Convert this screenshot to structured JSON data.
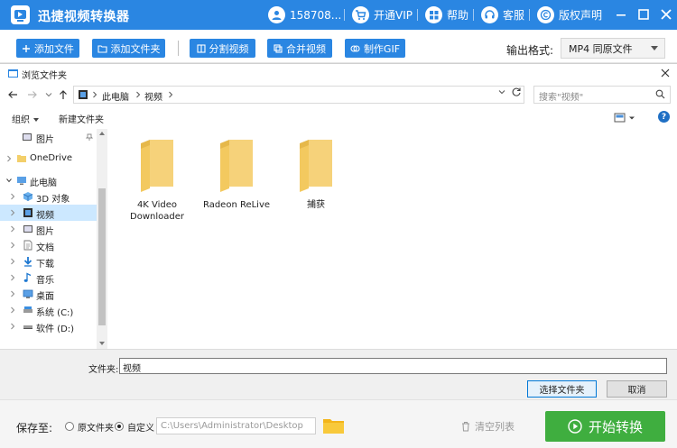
{
  "app": {
    "title": "迅捷视频转换器",
    "user": "158708...",
    "vip_label": "开通VIP",
    "help_label": "帮助",
    "service_label": "客服",
    "copyright_label": "版权声明"
  },
  "toolbar": {
    "add_file": "添加文件",
    "add_folder": "添加文件夹",
    "split_video": "分割视频",
    "merge_video": "合并视频",
    "make_gif": "制作GIF",
    "output_format_label": "输出格式:",
    "output_format_value": "MP4  同原文件"
  },
  "dialog": {
    "title": "浏览文件夹",
    "breadcrumb": [
      "此电脑",
      "视频"
    ],
    "search_placeholder": "搜索\"视频\"",
    "organize": "组织",
    "new_folder": "新建文件夹",
    "nav_items": [
      {
        "label": "图片",
        "icon": "pictures-icon",
        "indent": 1,
        "pinned": true
      },
      {
        "label": "OneDrive",
        "icon": "onedrive-folder-icon",
        "indent": 0
      },
      {
        "label": "此电脑",
        "icon": "this-pc-icon",
        "indent": 0,
        "expanded": true
      },
      {
        "label": "3D 对象",
        "icon": "3d-objects-icon",
        "indent": 1
      },
      {
        "label": "视频",
        "icon": "videos-icon",
        "indent": 1,
        "selected": true
      },
      {
        "label": "图片",
        "icon": "pictures-icon",
        "indent": 1
      },
      {
        "label": "文档",
        "icon": "documents-icon",
        "indent": 1
      },
      {
        "label": "下载",
        "icon": "downloads-icon",
        "indent": 1
      },
      {
        "label": "音乐",
        "icon": "music-icon",
        "indent": 1
      },
      {
        "label": "桌面",
        "icon": "desktop-icon",
        "indent": 1
      },
      {
        "label": "系统 (C:)",
        "icon": "drive-c-icon",
        "indent": 1
      },
      {
        "label": "软件 (D:)",
        "icon": "drive-d-icon",
        "indent": 1
      }
    ],
    "files": [
      {
        "name_line1": "4K Video",
        "name_line2": "Downloader"
      },
      {
        "name_line1": "Radeon ReLive",
        "name_line2": ""
      },
      {
        "name_line1": "捕获",
        "name_line2": ""
      }
    ],
    "folder_label": "文件夹:",
    "folder_value": "视频",
    "select_folder": "选择文件夹",
    "cancel": "取消"
  },
  "bottom": {
    "save_to_label": "保存至:",
    "option_source": "原文件夹",
    "option_custom": "自定义",
    "selected_option": "custom",
    "path": "C:\\Users\\Administrator\\Desktop",
    "clear_list": "清空列表",
    "start": "开始转换"
  },
  "colors": {
    "brand_blue": "#2a86e2",
    "start_green": "#3fae3f",
    "selected_nav": "#cce8ff"
  }
}
